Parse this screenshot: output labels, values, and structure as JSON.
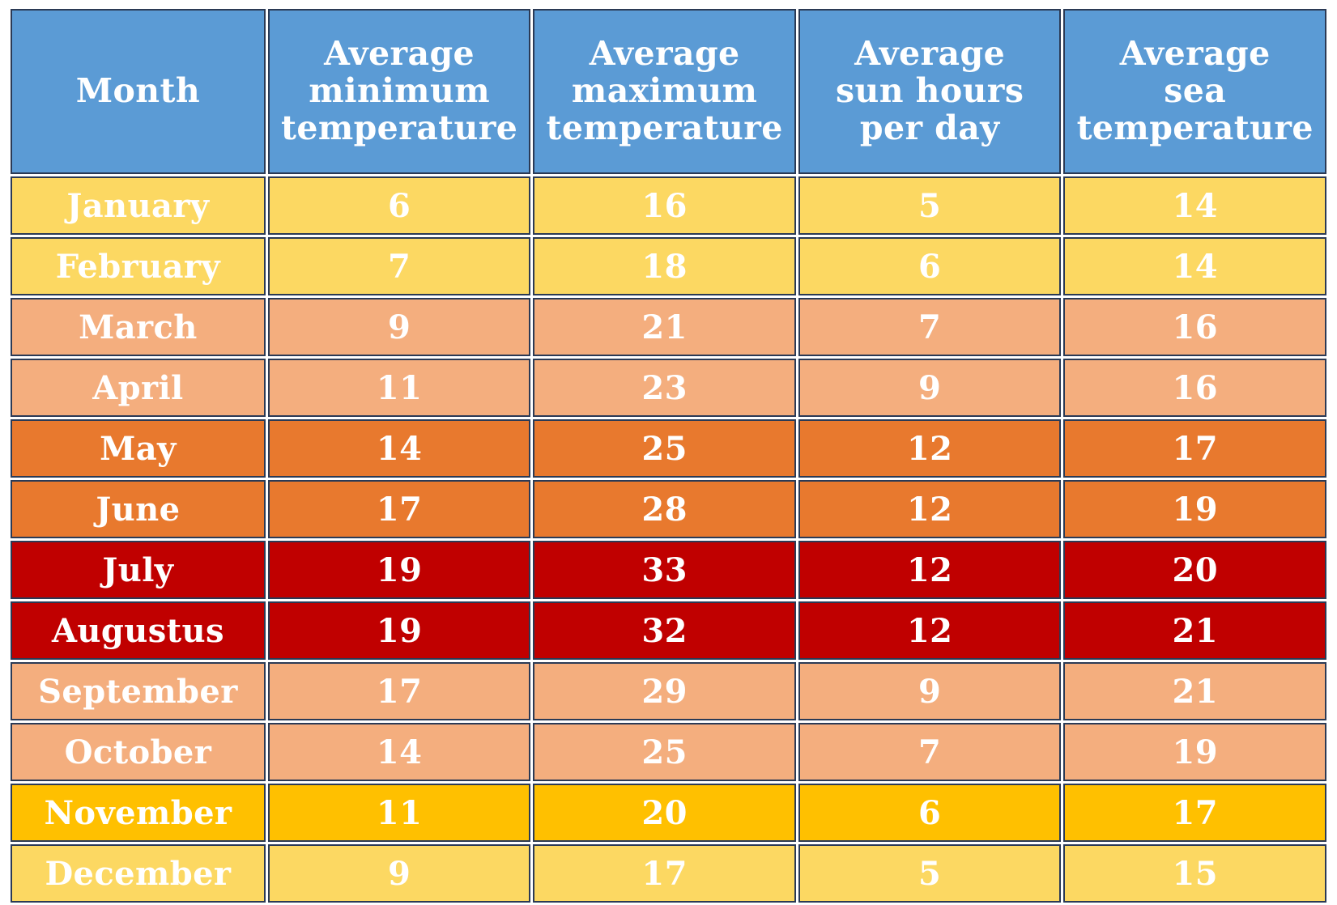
{
  "table": {
    "columns": [
      {
        "key": "month",
        "lines": [
          "Month"
        ]
      },
      {
        "key": "tmin",
        "lines": [
          "Average",
          "minimum",
          "temperature"
        ]
      },
      {
        "key": "tmax",
        "lines": [
          "Average",
          "maximum",
          "temperature"
        ]
      },
      {
        "key": "sun",
        "lines": [
          "Average",
          "sun hours",
          "per day"
        ]
      },
      {
        "key": "sea",
        "lines": [
          "Average",
          "sea",
          "temperature"
        ]
      }
    ],
    "rows": [
      {
        "month": "January",
        "tmin": "6",
        "tmax": "16",
        "sun": "5",
        "sea": "14",
        "band": "yellow"
      },
      {
        "month": "February",
        "tmin": "7",
        "tmax": "18",
        "sun": "6",
        "sea": "14",
        "band": "yellow"
      },
      {
        "month": "March",
        "tmin": "9",
        "tmax": "21",
        "sun": "7",
        "sea": "16",
        "band": "peach"
      },
      {
        "month": "April",
        "tmin": "11",
        "tmax": "23",
        "sun": "9",
        "sea": "16",
        "band": "peach"
      },
      {
        "month": "May",
        "tmin": "14",
        "tmax": "25",
        "sun": "12",
        "sea": "17",
        "band": "orange"
      },
      {
        "month": "June",
        "tmin": "17",
        "tmax": "28",
        "sun": "12",
        "sea": "19",
        "band": "orange"
      },
      {
        "month": "July",
        "tmin": "19",
        "tmax": "33",
        "sun": "12",
        "sea": "20",
        "band": "red"
      },
      {
        "month": "Augustus",
        "tmin": "19",
        "tmax": "32",
        "sun": "12",
        "sea": "21",
        "band": "red"
      },
      {
        "month": "September",
        "tmin": "17",
        "tmax": "29",
        "sun": "9",
        "sea": "21",
        "band": "peach"
      },
      {
        "month": "October",
        "tmin": "14",
        "tmax": "25",
        "sun": "7",
        "sea": "19",
        "band": "peach"
      },
      {
        "month": "November",
        "tmin": "11",
        "tmax": "20",
        "sun": "6",
        "sea": "17",
        "band": "amber"
      },
      {
        "month": "December",
        "tmin": "9",
        "tmax": "17",
        "sun": "5",
        "sea": "15",
        "band": "yellow"
      }
    ]
  },
  "colors": {
    "header_blue": "#5B9BD5",
    "band_yellow": "#FCD862",
    "band_peach": "#F4AE7E",
    "band_orange": "#E8792E",
    "band_red": "#C00000",
    "band_amber": "#FFC000",
    "border": "#2B3A55",
    "text": "#FFFFFF",
    "page_background": "#FFFFFF"
  },
  "chart_data": {
    "type": "table",
    "title": "Monthly climate averages",
    "categories": [
      "January",
      "February",
      "March",
      "April",
      "May",
      "June",
      "July",
      "Augustus",
      "September",
      "October",
      "November",
      "December"
    ],
    "series": [
      {
        "name": "Average minimum temperature",
        "values": [
          6,
          7,
          9,
          11,
          14,
          17,
          19,
          19,
          17,
          14,
          11,
          9
        ]
      },
      {
        "name": "Average maximum temperature",
        "values": [
          16,
          18,
          21,
          23,
          25,
          28,
          33,
          32,
          29,
          25,
          20,
          17
        ]
      },
      {
        "name": "Average sun hours per day",
        "values": [
          5,
          6,
          7,
          9,
          12,
          12,
          12,
          12,
          9,
          7,
          6,
          5
        ]
      },
      {
        "name": "Average sea temperature",
        "values": [
          14,
          14,
          16,
          16,
          17,
          19,
          20,
          21,
          21,
          19,
          17,
          15
        ]
      }
    ],
    "xlabel": "Month",
    "ylabel": "",
    "legend": "none",
    "grid": true
  }
}
